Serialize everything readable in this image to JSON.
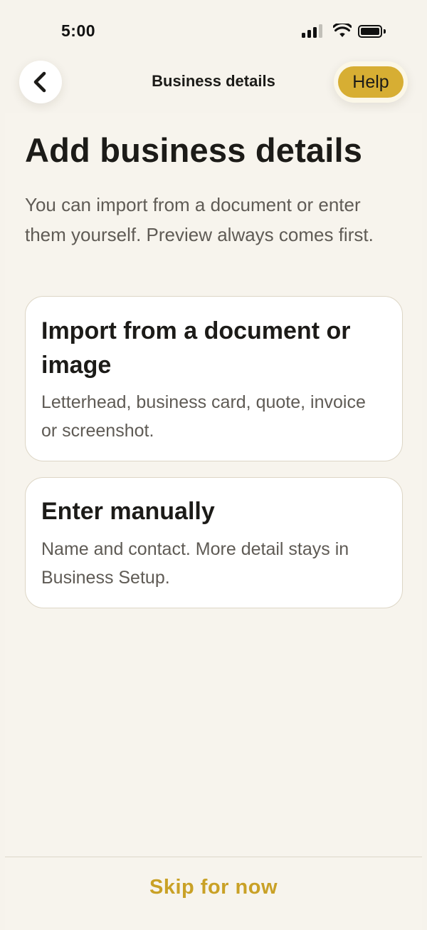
{
  "status_bar": {
    "time": "5:00",
    "signal_icon": "cellular-signal-icon",
    "wifi_icon": "wifi-icon",
    "battery_icon": "battery-icon"
  },
  "nav": {
    "back_icon": "chevron-left-icon",
    "title": "Business details",
    "help_label": "Help"
  },
  "content": {
    "heading": "Add business details",
    "intro": "You can import from a document or enter them yourself. Preview always comes first.",
    "options": [
      {
        "title": "Import from a document or image",
        "description": "Letterhead, business card, quote, invoice or screenshot."
      },
      {
        "title": "Enter manually",
        "description": "Name and contact. More detail stays in Business Setup."
      }
    ]
  },
  "footer": {
    "skip_label": "Skip for now"
  },
  "colors": {
    "accent": "#d7ae33",
    "accent_text": "#c9a126",
    "background": "#f7f4ed",
    "card_border": "#ddd6c6"
  }
}
